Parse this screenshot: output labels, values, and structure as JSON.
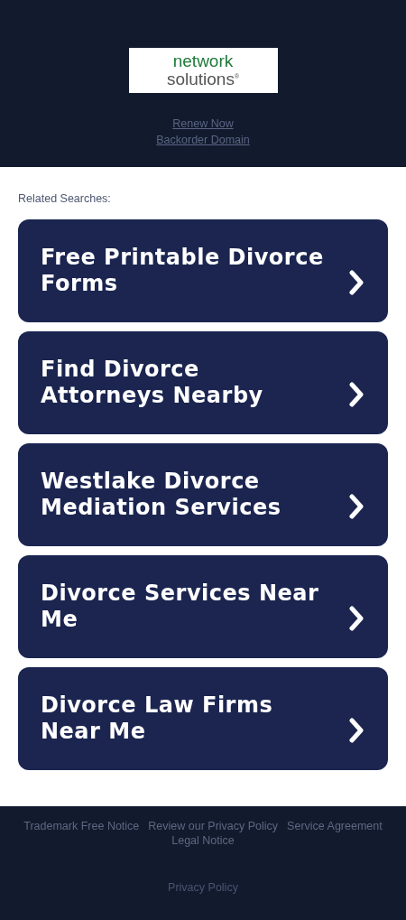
{
  "header": {
    "logo": {
      "line_1": "network",
      "line_2": "solutions$^{®}$"
    },
    "links": [
      "Renew Now",
      "Backorder Domain"
    ]
  },
  "related": {
    "title": "Related Searches:",
    "items": [
      {
        "label": "Free Printable Divorce Forms"
      },
      {
        "label": "Find Divorce Attorneys Nearby"
      },
      {
        "label": "Westlake Divorce Mediation Services"
      },
      {
        "label": "Divorce Services Near Me"
      },
      {
        "label": "Divorce Law Firms Near Me"
      }
    ]
  },
  "footer": {
    "links": [
      "Trademark Free Notice",
      "Review our Privacy Policy",
      "Service Agreement",
      "Legal Notice"
    ],
    "bottom_link": "Privacy Policy"
  }
}
